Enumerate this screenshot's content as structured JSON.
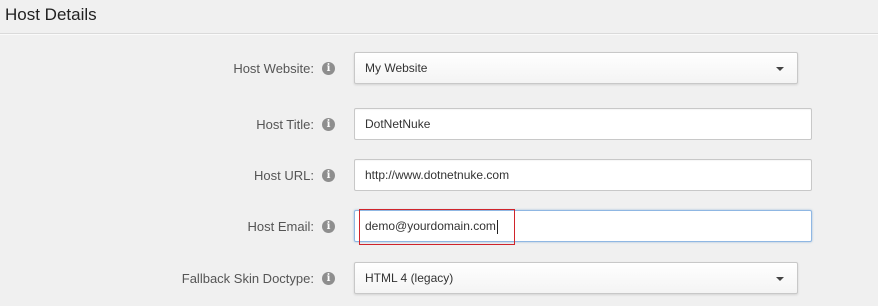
{
  "section": {
    "title": "Host Details"
  },
  "fields": {
    "host_website": {
      "label": "Host Website:",
      "value": "My Website",
      "icon": "info-icon"
    },
    "host_title": {
      "label": "Host Title:",
      "value": "DotNetNuke",
      "icon": "info-icon"
    },
    "host_url": {
      "label": "Host URL:",
      "value": "http://www.dotnetnuke.com",
      "icon": "info-icon"
    },
    "host_email": {
      "label": "Host Email:",
      "value": "demo@yourdomain.com",
      "icon": "info-icon"
    },
    "fallback_skin_doctype": {
      "label": "Fallback Skin Doctype:",
      "value": "HTML 4 (legacy)",
      "icon": "info-icon"
    }
  },
  "info_glyph": "i",
  "colors": {
    "highlight": "#d0242b",
    "focus_border": "#8fb7e3"
  }
}
